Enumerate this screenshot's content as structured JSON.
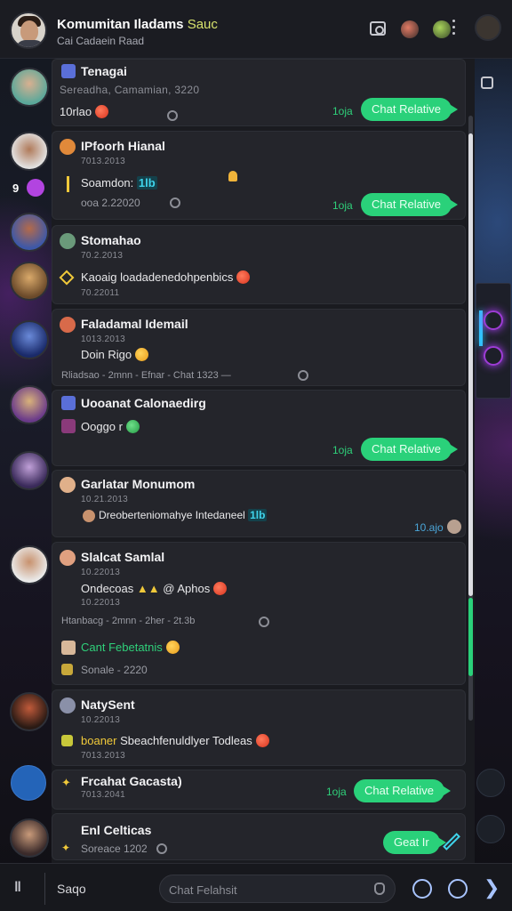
{
  "header": {
    "title": "Komumitan Iladams",
    "title_accent": "Sauc",
    "subtitle": "Cai Cadaein Raad"
  },
  "chats": [
    {
      "name": "Tenagai",
      "subtitle": "Sereadha, Camamian, 3220",
      "line": "10rlao",
      "button": "Chat Relative",
      "time": "1oja"
    },
    {
      "name": "IPfoorh Hianal",
      "meta": "7013.2013",
      "line": "Soamdon:",
      "tag": "1lb",
      "footer": "ooa 2.22020",
      "button": "Chat Relative",
      "time": "1oja"
    },
    {
      "name": "Stomahao",
      "meta": "70.2.2013",
      "line": "Kaoaig loadadenedohpenbics",
      "meta2": "70.22011"
    },
    {
      "name": "Faladamal Idemail",
      "meta": "1013.2013",
      "line": "Doin Rigo",
      "sys": "Rliadsao - 2mnn - Efnar - Chat 1323 —"
    },
    {
      "name": "Uooanat Calonaedirg",
      "line": "Ooggo r",
      "button": "Chat Relative",
      "time": "1oja"
    },
    {
      "name": "Garlatar Monumom",
      "meta": "10.21.2013",
      "line": "Dreoberteniomahye Intedaneel",
      "tag": "1lb",
      "time": "10.ajo"
    },
    {
      "name": "Slalcat Samlal",
      "meta": "10.22013",
      "line": "Ondecoas",
      "line_mid": "@ Aphos",
      "meta2": "10.22013",
      "sys": "Htanbacg - 2mnn - 2her - 2t.3b",
      "green_line": "Cant Febetatnis",
      "footer": "Sonale - 2220"
    },
    {
      "name": "NatySent",
      "meta": "10.22013",
      "line_yellow": "boaner",
      "line": "Sbeachfenuldlyer Todleas",
      "meta2": "7013.2013"
    },
    {
      "name": "Frcahat Gacasta)",
      "meta": "7013.2041",
      "button": "Chat Relative",
      "time": "1oja"
    },
    {
      "name": "Enl Celticas",
      "footer": "Soreace 1202",
      "button": "Geat Ir"
    }
  ],
  "bottom": {
    "left_label": "Saqo",
    "compose_placeholder": "Chat Felahsit"
  },
  "colors": {
    "accent_green": "#2ad17a",
    "panel": "#1a1b20",
    "card": "#24252b"
  },
  "icons": [
    "camera-icon",
    "more-icon",
    "send-icon",
    "clock-icon",
    "compass-icon",
    "edit-icon"
  ]
}
